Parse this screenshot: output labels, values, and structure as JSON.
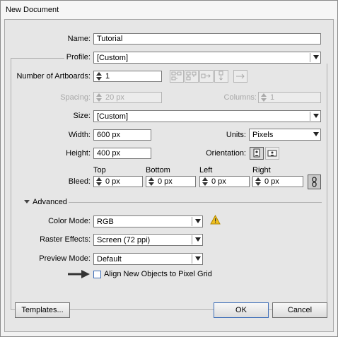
{
  "window": {
    "title": "New Document"
  },
  "name": {
    "label": "Name:",
    "value": "Tutorial"
  },
  "profile": {
    "label": "Profile:",
    "value": "[Custom]"
  },
  "artboards": {
    "label": "Number of Artboards:",
    "value": "1"
  },
  "spacing": {
    "label": "Spacing:",
    "value": "20 px"
  },
  "columns": {
    "label": "Columns:",
    "value": "1"
  },
  "size": {
    "label": "Size:",
    "value": "[Custom]"
  },
  "width": {
    "label": "Width:",
    "value": "600 px"
  },
  "units": {
    "label": "Units:",
    "value": "Pixels"
  },
  "height": {
    "label": "Height:",
    "value": "400 px"
  },
  "orientation": {
    "label": "Orientation:"
  },
  "bleed": {
    "label": "Bleed:",
    "top": {
      "label": "Top",
      "value": "0 px"
    },
    "bottom": {
      "label": "Bottom",
      "value": "0 px"
    },
    "left": {
      "label": "Left",
      "value": "0 px"
    },
    "right": {
      "label": "Right",
      "value": "0 px"
    }
  },
  "advanced": {
    "label": "Advanced",
    "color_mode": {
      "label": "Color Mode:",
      "value": "RGB"
    },
    "raster_effects": {
      "label": "Raster Effects:",
      "value": "Screen (72 ppi)"
    },
    "preview_mode": {
      "label": "Preview Mode:",
      "value": "Default"
    },
    "align_pixel_grid": {
      "label": "Align New Objects to Pixel Grid",
      "checked": false
    }
  },
  "buttons": {
    "templates": "Templates...",
    "ok": "OK",
    "cancel": "Cancel"
  },
  "colors": {
    "warning": "#f0c020",
    "checkbox_border": "#3f6fb8"
  }
}
